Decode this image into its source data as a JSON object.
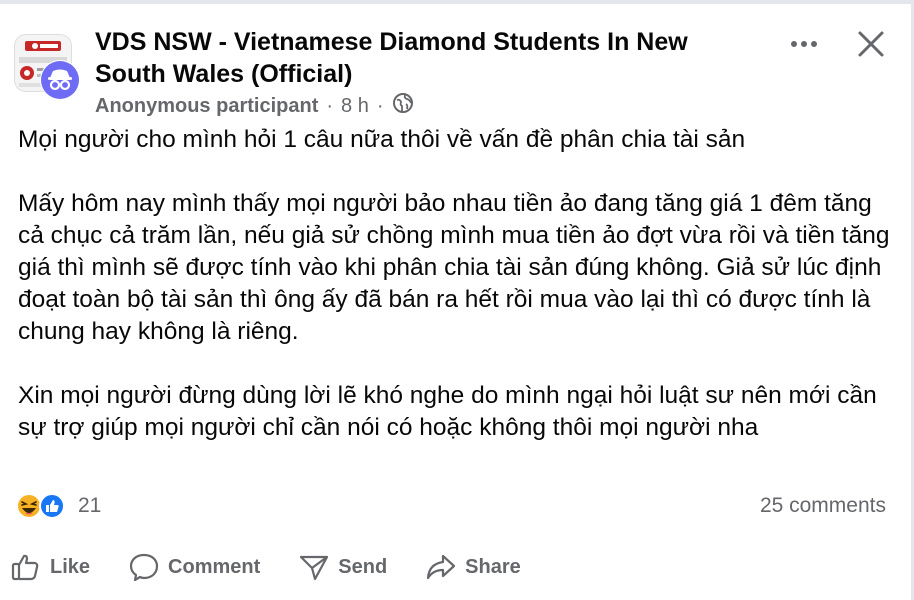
{
  "post": {
    "group_name": "VDS NSW - Vietnamese Diamond Students In New South Wales (Official)",
    "author": "Anonymous participant",
    "separator": "·",
    "time": "8 h",
    "privacy_icon": "globe-icon",
    "paragraphs": [
      "Mọi người cho mình hỏi 1 câu nữa thôi về vấn đề phân chia tài sản",
      "Mấy hôm nay mình thấy mọi người bảo nhau tiền ảo đang tăng giá 1 đêm tăng cả chục cả trăm lần, nếu giả sử chồng mình mua tiền ảo đợt vừa rồi và tiền tăng giá thì mình sẽ được tính vào khi phân chia tài sản đúng không. Giả sử lúc định đoạt toàn bộ tài sản thì ông ấy đã bán ra hết rồi mua vào lại thì có được tính là chung hay không là riêng.",
      "Xin mọi người đừng dùng lời lẽ khó nghe do mình ngại hỏi luật sư nên mới cần sự trợ giúp mọi người chỉ cần nói có hoặc không thôi mọi người nha"
    ],
    "reaction_count": "21",
    "comments_count": "25 comments"
  },
  "actions": {
    "like": "Like",
    "comment": "Comment",
    "send": "Send",
    "share": "Share"
  },
  "colors": {
    "text": "#080809",
    "secondary": "#65676b",
    "like_blue": "#1877f2",
    "haha_yellow": "#f7b125"
  }
}
